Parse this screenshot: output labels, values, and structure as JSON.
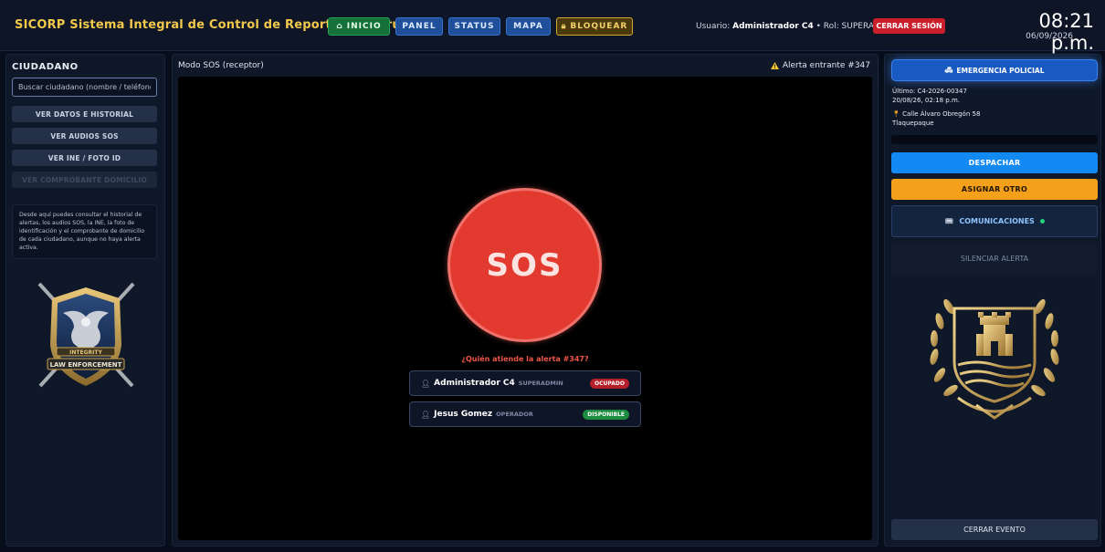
{
  "header": {
    "title": "SICORP Sistema Integral de Control de Reportes y Patrullaje",
    "nav": {
      "inicio": "INICIO",
      "panel": "PANEL",
      "status": "STATUS",
      "mapa": "MAPA",
      "bloquear": "BLOQUEAR"
    },
    "user_prefix": "Usuario:",
    "user_name": "Administrador C4",
    "role_text": "• Rol: SUPERADMIN",
    "logout": "CERRAR SESIÓN",
    "time": "08:21 p.m.",
    "date": "06/09/2026"
  },
  "sidebar": {
    "title": "CIUDADANO",
    "search_placeholder": "Buscar ciudadano (nombre / teléfono / CURP)",
    "buttons": [
      "VER DATOS E HISTORIAL",
      "VER AUDIOS SOS",
      "VER INE / FOTO ID",
      "VER COMPROBANTE DOMICILIO"
    ],
    "info": "Desde aquí puedes consultar el historial de alertas, los audios SOS, la INE, la foto de identificación y el comprobante de domicilio de cada ciudadano, aunque no haya alerta activa.",
    "emblem_text": {
      "top": "INTEGRITY",
      "bottom": "LAW ENFORCEMENT"
    }
  },
  "main": {
    "mode": "Modo SOS (receptor)",
    "alert": "Alerta entrante #347",
    "sos_label": "SOS",
    "question": "¿Quién atiende la alerta #347?",
    "responders": [
      {
        "name": "Administrador C4",
        "role": "SUPERADMIN",
        "status": "OCUPADO"
      },
      {
        "name": "Jesus Gomez",
        "role": "OPERADOR",
        "status": "DISPONIBLE"
      }
    ]
  },
  "right": {
    "emergency": "EMERGENCIA POLICIAL",
    "last_line1": "Último: C4-2026-00347",
    "last_line2": "20/08/26, 02:18 p.m.",
    "address_line1": "Calle Álvaro Obregón 58",
    "address_line2": "Tlaquepaque",
    "dispatch": "DESPACHAR",
    "assign": "ASIGNAR OTRO",
    "comms": "COMUNICACIONES",
    "silence": "SILENCIAR ALERTA",
    "close_event": "CERRAR EVENTO"
  },
  "colors": {
    "accent_gold": "#f2c94c",
    "sos_red": "#e33a30",
    "dispatch_blue": "#1389f4",
    "assign_orange": "#f5a01a",
    "busy_red": "#b3202a",
    "free_green": "#1b8c3f"
  }
}
